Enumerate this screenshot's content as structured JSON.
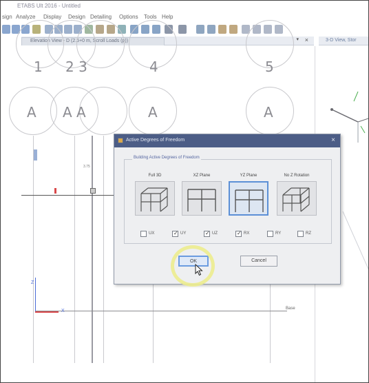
{
  "app": {
    "title": "ETABS Ult 2016 - Untitled"
  },
  "menubar": {
    "items": [
      "sign",
      "Analyze",
      "Display",
      "Design",
      "Detailing",
      "Options",
      "Tools",
      "Help"
    ]
  },
  "tabs": {
    "left_label": "Elevation View - D (2.5+0 m, Scroll Loads (p))",
    "right_label": "3-D View, Stor",
    "pin": "▾",
    "close": "×"
  },
  "grid": {
    "number_labels": [
      "1",
      "2 3",
      "4",
      "5"
    ],
    "letter_labels": [
      "A",
      "A A",
      "A",
      "A"
    ],
    "elevation_tag": "3.75",
    "base_tag": "Base",
    "z_axis": "Z",
    "x_axis": "X"
  },
  "dialog": {
    "title": "Active Degrees of Freedom",
    "close": "×",
    "group_label": "Building Active Degrees of Freedom",
    "options": [
      {
        "label": "Full 3D",
        "selected": false
      },
      {
        "label": "XZ Plane",
        "selected": false
      },
      {
        "label": "YZ Plane",
        "selected": true
      },
      {
        "label": "No Z Rotation",
        "selected": false
      }
    ],
    "dofs": [
      {
        "label": "UX",
        "checked": false
      },
      {
        "label": "UY",
        "checked": true
      },
      {
        "label": "UZ",
        "checked": true
      },
      {
        "label": "RX",
        "checked": true
      },
      {
        "label": "RY",
        "checked": false
      },
      {
        "label": "RZ",
        "checked": false
      }
    ],
    "ok_label": "OK",
    "cancel_label": "Cancel"
  },
  "colors": {
    "dialog_title_bg": "#4c5d86",
    "selected_border": "#5b8fd6",
    "highlight_ring": "#ecec8e",
    "axis_red": "#d9484a",
    "axis_blue": "#4a6ad6"
  },
  "icons": {
    "dialog_app": "etabs-icon",
    "cursor": "mouse-pointer-icon"
  }
}
